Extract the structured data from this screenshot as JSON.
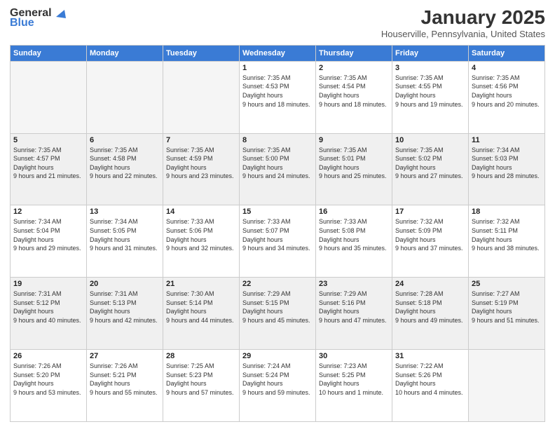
{
  "header": {
    "logo_general": "General",
    "logo_blue": "Blue",
    "month_title": "January 2025",
    "location": "Houserville, Pennsylvania, United States"
  },
  "days_of_week": [
    "Sunday",
    "Monday",
    "Tuesday",
    "Wednesday",
    "Thursday",
    "Friday",
    "Saturday"
  ],
  "weeks": [
    [
      {
        "day": "",
        "empty": true
      },
      {
        "day": "",
        "empty": true
      },
      {
        "day": "",
        "empty": true
      },
      {
        "day": "1",
        "sunrise": "7:35 AM",
        "sunset": "4:53 PM",
        "daylight": "9 hours and 18 minutes."
      },
      {
        "day": "2",
        "sunrise": "7:35 AM",
        "sunset": "4:54 PM",
        "daylight": "9 hours and 18 minutes."
      },
      {
        "day": "3",
        "sunrise": "7:35 AM",
        "sunset": "4:55 PM",
        "daylight": "9 hours and 19 minutes."
      },
      {
        "day": "4",
        "sunrise": "7:35 AM",
        "sunset": "4:56 PM",
        "daylight": "9 hours and 20 minutes."
      }
    ],
    [
      {
        "day": "5",
        "sunrise": "7:35 AM",
        "sunset": "4:57 PM",
        "daylight": "9 hours and 21 minutes."
      },
      {
        "day": "6",
        "sunrise": "7:35 AM",
        "sunset": "4:58 PM",
        "daylight": "9 hours and 22 minutes."
      },
      {
        "day": "7",
        "sunrise": "7:35 AM",
        "sunset": "4:59 PM",
        "daylight": "9 hours and 23 minutes."
      },
      {
        "day": "8",
        "sunrise": "7:35 AM",
        "sunset": "5:00 PM",
        "daylight": "9 hours and 24 minutes."
      },
      {
        "day": "9",
        "sunrise": "7:35 AM",
        "sunset": "5:01 PM",
        "daylight": "9 hours and 25 minutes."
      },
      {
        "day": "10",
        "sunrise": "7:35 AM",
        "sunset": "5:02 PM",
        "daylight": "9 hours and 27 minutes."
      },
      {
        "day": "11",
        "sunrise": "7:34 AM",
        "sunset": "5:03 PM",
        "daylight": "9 hours and 28 minutes."
      }
    ],
    [
      {
        "day": "12",
        "sunrise": "7:34 AM",
        "sunset": "5:04 PM",
        "daylight": "9 hours and 29 minutes."
      },
      {
        "day": "13",
        "sunrise": "7:34 AM",
        "sunset": "5:05 PM",
        "daylight": "9 hours and 31 minutes."
      },
      {
        "day": "14",
        "sunrise": "7:33 AM",
        "sunset": "5:06 PM",
        "daylight": "9 hours and 32 minutes."
      },
      {
        "day": "15",
        "sunrise": "7:33 AM",
        "sunset": "5:07 PM",
        "daylight": "9 hours and 34 minutes."
      },
      {
        "day": "16",
        "sunrise": "7:33 AM",
        "sunset": "5:08 PM",
        "daylight": "9 hours and 35 minutes."
      },
      {
        "day": "17",
        "sunrise": "7:32 AM",
        "sunset": "5:09 PM",
        "daylight": "9 hours and 37 minutes."
      },
      {
        "day": "18",
        "sunrise": "7:32 AM",
        "sunset": "5:11 PM",
        "daylight": "9 hours and 38 minutes."
      }
    ],
    [
      {
        "day": "19",
        "sunrise": "7:31 AM",
        "sunset": "5:12 PM",
        "daylight": "9 hours and 40 minutes."
      },
      {
        "day": "20",
        "sunrise": "7:31 AM",
        "sunset": "5:13 PM",
        "daylight": "9 hours and 42 minutes."
      },
      {
        "day": "21",
        "sunrise": "7:30 AM",
        "sunset": "5:14 PM",
        "daylight": "9 hours and 44 minutes."
      },
      {
        "day": "22",
        "sunrise": "7:29 AM",
        "sunset": "5:15 PM",
        "daylight": "9 hours and 45 minutes."
      },
      {
        "day": "23",
        "sunrise": "7:29 AM",
        "sunset": "5:16 PM",
        "daylight": "9 hours and 47 minutes."
      },
      {
        "day": "24",
        "sunrise": "7:28 AM",
        "sunset": "5:18 PM",
        "daylight": "9 hours and 49 minutes."
      },
      {
        "day": "25",
        "sunrise": "7:27 AM",
        "sunset": "5:19 PM",
        "daylight": "9 hours and 51 minutes."
      }
    ],
    [
      {
        "day": "26",
        "sunrise": "7:26 AM",
        "sunset": "5:20 PM",
        "daylight": "9 hours and 53 minutes."
      },
      {
        "day": "27",
        "sunrise": "7:26 AM",
        "sunset": "5:21 PM",
        "daylight": "9 hours and 55 minutes."
      },
      {
        "day": "28",
        "sunrise": "7:25 AM",
        "sunset": "5:23 PM",
        "daylight": "9 hours and 57 minutes."
      },
      {
        "day": "29",
        "sunrise": "7:24 AM",
        "sunset": "5:24 PM",
        "daylight": "9 hours and 59 minutes."
      },
      {
        "day": "30",
        "sunrise": "7:23 AM",
        "sunset": "5:25 PM",
        "daylight": "10 hours and 1 minute."
      },
      {
        "day": "31",
        "sunrise": "7:22 AM",
        "sunset": "5:26 PM",
        "daylight": "10 hours and 4 minutes."
      },
      {
        "day": "",
        "empty": true
      }
    ]
  ],
  "labels": {
    "sunrise": "Sunrise:",
    "sunset": "Sunset:",
    "daylight": "Daylight hours"
  }
}
